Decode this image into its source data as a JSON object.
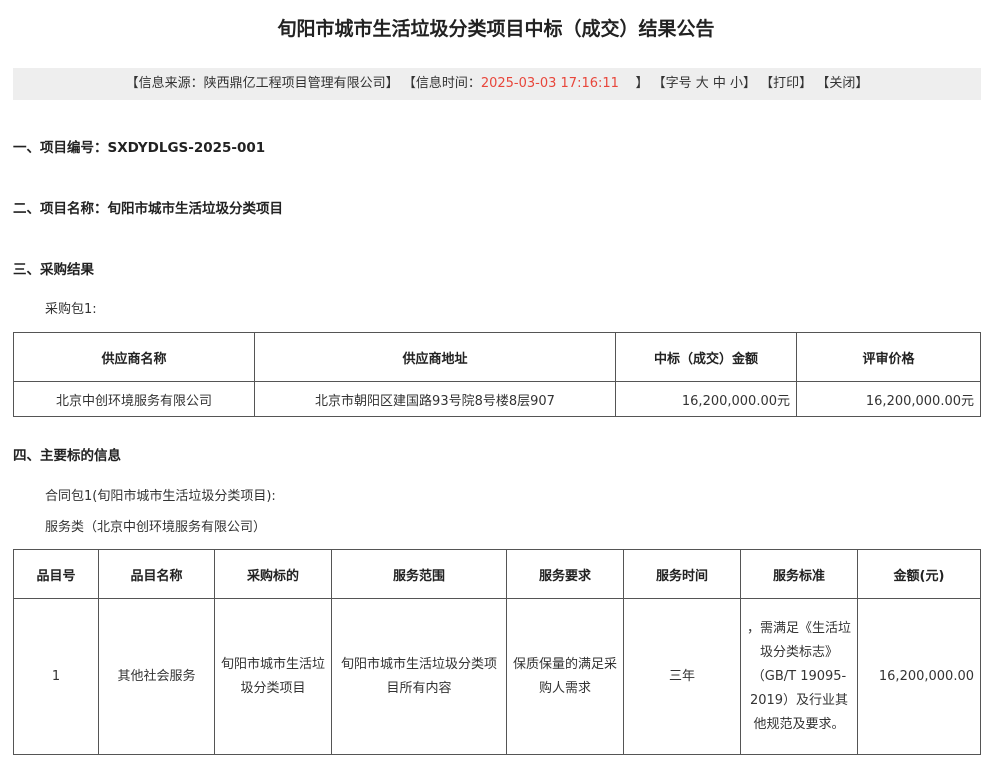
{
  "title": "旬阳市城市生活垃圾分类项目中标（成交）结果公告",
  "info": {
    "source_label": "【信息来源：陕西鼎亿工程项目管理有限公司】",
    "time_label": "【信息时间：",
    "time_value": "2025-03-03 17:16:11",
    "time_end": "】",
    "font_size": "【字号 大 中 小】",
    "print": "【打印】",
    "close": "【关闭】"
  },
  "sections": {
    "s1": "一、项目编号：SXDYDLGS-2025-001",
    "s2": "二、项目名称：旬阳市城市生活垃圾分类项目",
    "s3": "三、采购结果",
    "s3_pkg": "采购包1:",
    "s4": "四、主要标的信息",
    "s4_contract": "合同包1(旬阳市城市生活垃圾分类项目):",
    "s4_type": "服务类（北京中创环境服务有限公司）"
  },
  "result_table": {
    "headers": [
      "供应商名称",
      "供应商地址",
      "中标（成交）金额",
      "评审价格"
    ],
    "row": [
      "北京中创环境服务有限公司",
      "北京市朝阳区建国路93号院8号楼8层907",
      "16,200,000.00元",
      "16,200,000.00元"
    ]
  },
  "item_table": {
    "headers": [
      "品目号",
      "品目名称",
      "采购标的",
      "服务范围",
      "服务要求",
      "服务时间",
      "服务标准",
      "金额(元)"
    ],
    "row": [
      "1",
      "其他社会服务",
      "旬阳市城市生活垃圾分类项目",
      "旬阳市城市生活垃圾分类项目所有内容",
      "保质保量的满足采购人需求",
      "三年",
      "，需满足《生活垃圾分类标志》（GB/T 19095-2019）及行业其他规范及要求。",
      "16,200,000.00"
    ]
  }
}
